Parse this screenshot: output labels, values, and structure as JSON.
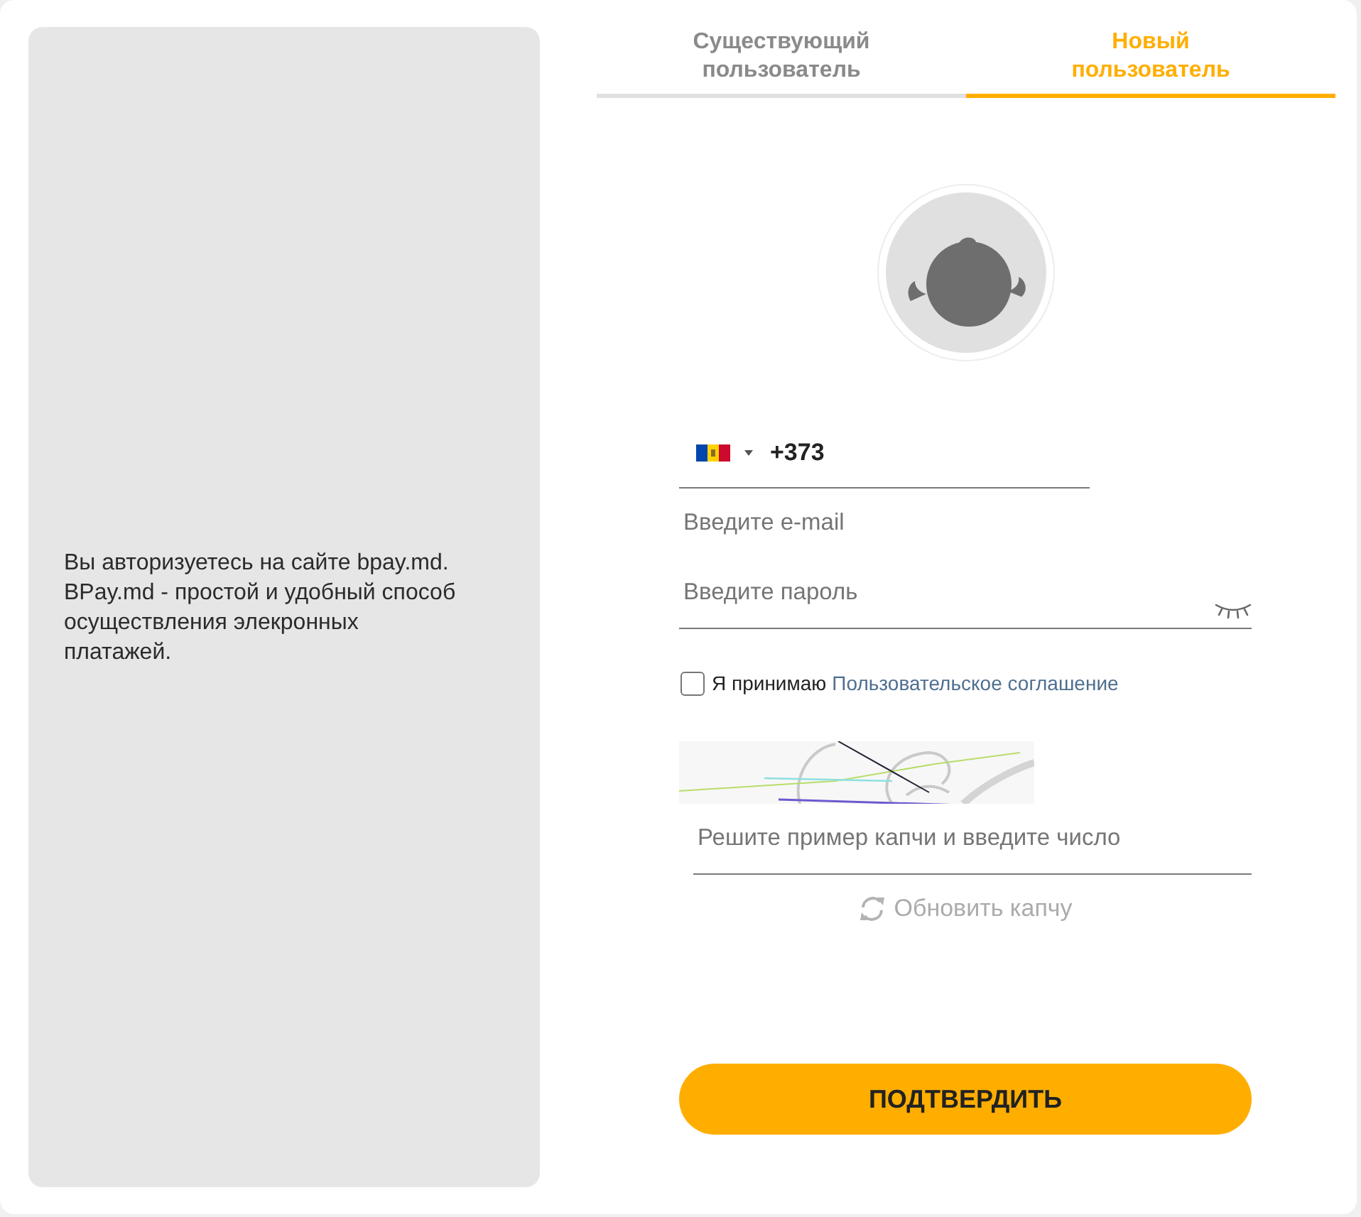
{
  "info_panel": {
    "text": "Вы авторизуетесь на сайте bpay.md. BPay.md - простой и удобный способ осуществления элекронных платажей."
  },
  "tabs": [
    {
      "label": "Существующий пользователь",
      "selected": false
    },
    {
      "label": "Новый пользователь",
      "selected": true
    }
  ],
  "phone": {
    "value": "+373"
  },
  "email": {
    "placeholder": "Введите e-mail"
  },
  "password": {
    "placeholder": "Введите пароль"
  },
  "agreement": {
    "checked": false,
    "text": "Я принимаю",
    "link": "Пользовательское соглашение"
  },
  "captcha": {
    "placeholder": "Решите пример капчи и введите число",
    "refresh": "Обновить капчу"
  },
  "submit_button": "ПОДТВЕРДИТЬ"
}
